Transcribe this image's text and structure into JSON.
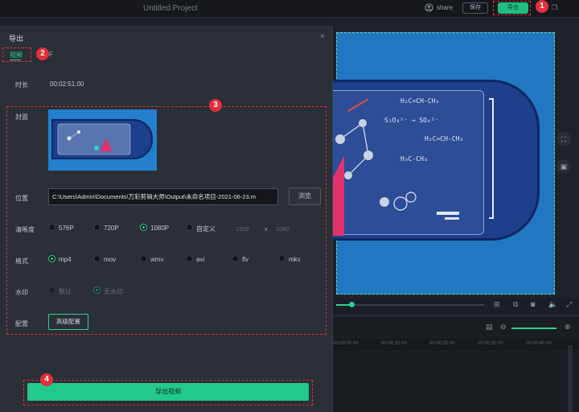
{
  "app": {
    "title": "Untitled Project",
    "share_label": "share",
    "save_label": "保存",
    "export_label": "导出"
  },
  "dialog": {
    "title": "导出",
    "close_glyph": "×",
    "tabs": [
      {
        "label": "视频",
        "active": true
      },
      {
        "label": "F",
        "active": false
      }
    ],
    "duration_label": "时长",
    "duration_value": "00:02:51.00",
    "cover_label": "封面",
    "location_label": "位置",
    "location_value": "C:\\Users\\Admin\\Documents\\万彩剪辑大师\\Output\\未命名项目-2021-06-23.m",
    "browse_label": "浏览",
    "resolution_label": "清晰度",
    "resolution_options": [
      "576P",
      "720P",
      "1080P",
      "自定义"
    ],
    "resolution_selected": "1080P",
    "custom_width": "1920",
    "custom_times": "x",
    "custom_height": "1080",
    "format_label": "格式",
    "format_options": [
      "mp4",
      "mov",
      "wmv",
      "avi",
      "flv",
      "mkv"
    ],
    "format_selected": "mp4",
    "watermark_label": "水印",
    "watermark_options": [
      "默认",
      "无水印"
    ],
    "watermark_selected": "无水印",
    "config_label": "配置",
    "advanced_config_label": "高级配置",
    "export_video_label": "导出视频"
  },
  "preview": {
    "formulas": [
      "H₂C=CH-CH₃",
      "S₂O₈²⁻ → SO₄²⁻",
      "H₂C=CH-CH₃",
      "H₃C-CH₃"
    ]
  },
  "timeline": {
    "ticks": [
      "00:00:00.00",
      "00:00:10.00",
      "00:00:20.00",
      "00:00:30.00",
      "00:00:40.00"
    ]
  },
  "annotations": [
    "1",
    "2",
    "3",
    "4"
  ],
  "colors": {
    "accent": "#22c98a",
    "annotation": "#e0303a",
    "dialog_bg": "#2b2f37"
  }
}
